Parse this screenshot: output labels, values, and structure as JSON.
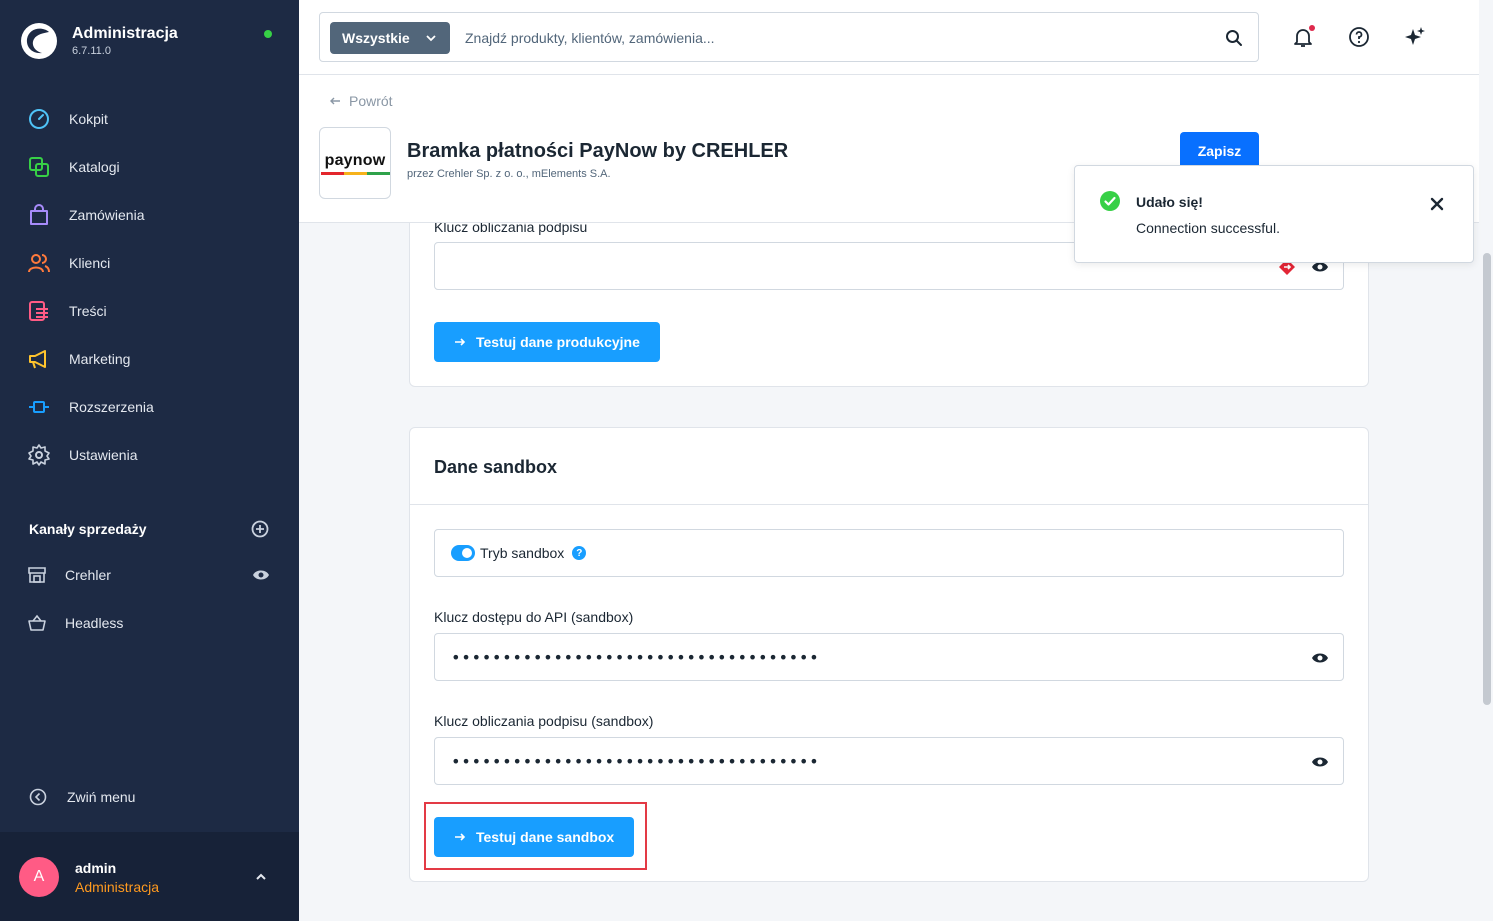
{
  "sidebar": {
    "brand_title": "Administracja",
    "brand_version": "6.7.11.0",
    "nav": [
      {
        "label": "Kokpit",
        "icon": "dashboard-icon",
        "color": "#4fc3f7"
      },
      {
        "label": "Katalogi",
        "icon": "catalog-icon",
        "color": "#37d046"
      },
      {
        "label": "Zamówienia",
        "icon": "orders-icon",
        "color": "#a78bfa"
      },
      {
        "label": "Klienci",
        "icon": "customers-icon",
        "color": "#ff7a3c"
      },
      {
        "label": "Treści",
        "icon": "content-icon",
        "color": "#ff5b85"
      },
      {
        "label": "Marketing",
        "icon": "marketing-icon",
        "color": "#ffc42d"
      },
      {
        "label": "Rozszerzenia",
        "icon": "extensions-icon",
        "color": "#189eff"
      },
      {
        "label": "Ustawienia",
        "icon": "settings-icon",
        "color": "#c9d1de"
      }
    ],
    "channels_title": "Kanały sprzedaży",
    "channels": [
      {
        "label": "Crehler",
        "icon": "storefront-icon"
      },
      {
        "label": "Headless",
        "icon": "basket-icon"
      }
    ],
    "collapse_label": "Zwiń menu",
    "user": {
      "initial": "A",
      "name": "admin",
      "role": "Administracja"
    }
  },
  "topbar": {
    "search_type": "Wszystkie",
    "search_placeholder": "Znajdź produkty, klientów, zamówienia..."
  },
  "header": {
    "back_label": "Powrót",
    "logo_text": "paynow",
    "title": "Bramka płatności PayNow by CREHLER",
    "subtitle": "przez Crehler Sp. z o. o., mElements S.A.",
    "save_label": "Zapisz"
  },
  "production": {
    "signature_label": "Klucz obliczania podpisu",
    "test_button": "Testuj dane produkcyjne"
  },
  "sandbox": {
    "title": "Dane sandbox",
    "switch_label": "Tryb sandbox",
    "switch_on": true,
    "help_glyph": "?",
    "api_key_label": "Klucz dostępu do API (sandbox)",
    "api_key_value": "••••••••••••••••••••••••••••••••••••",
    "signature_label": "Klucz obliczania podpisu (sandbox)",
    "signature_value": "••••••••••••••••••••••••••••••••••••",
    "test_button": "Testuj dane sandbox"
  },
  "toast": {
    "title": "Udało się!",
    "message": "Connection successful."
  },
  "colors": {
    "sidebar_bg": "#1d2a44",
    "primary": "#189eff",
    "save": "#0870ff",
    "success": "#37d046",
    "highlight": "#e33a45"
  }
}
